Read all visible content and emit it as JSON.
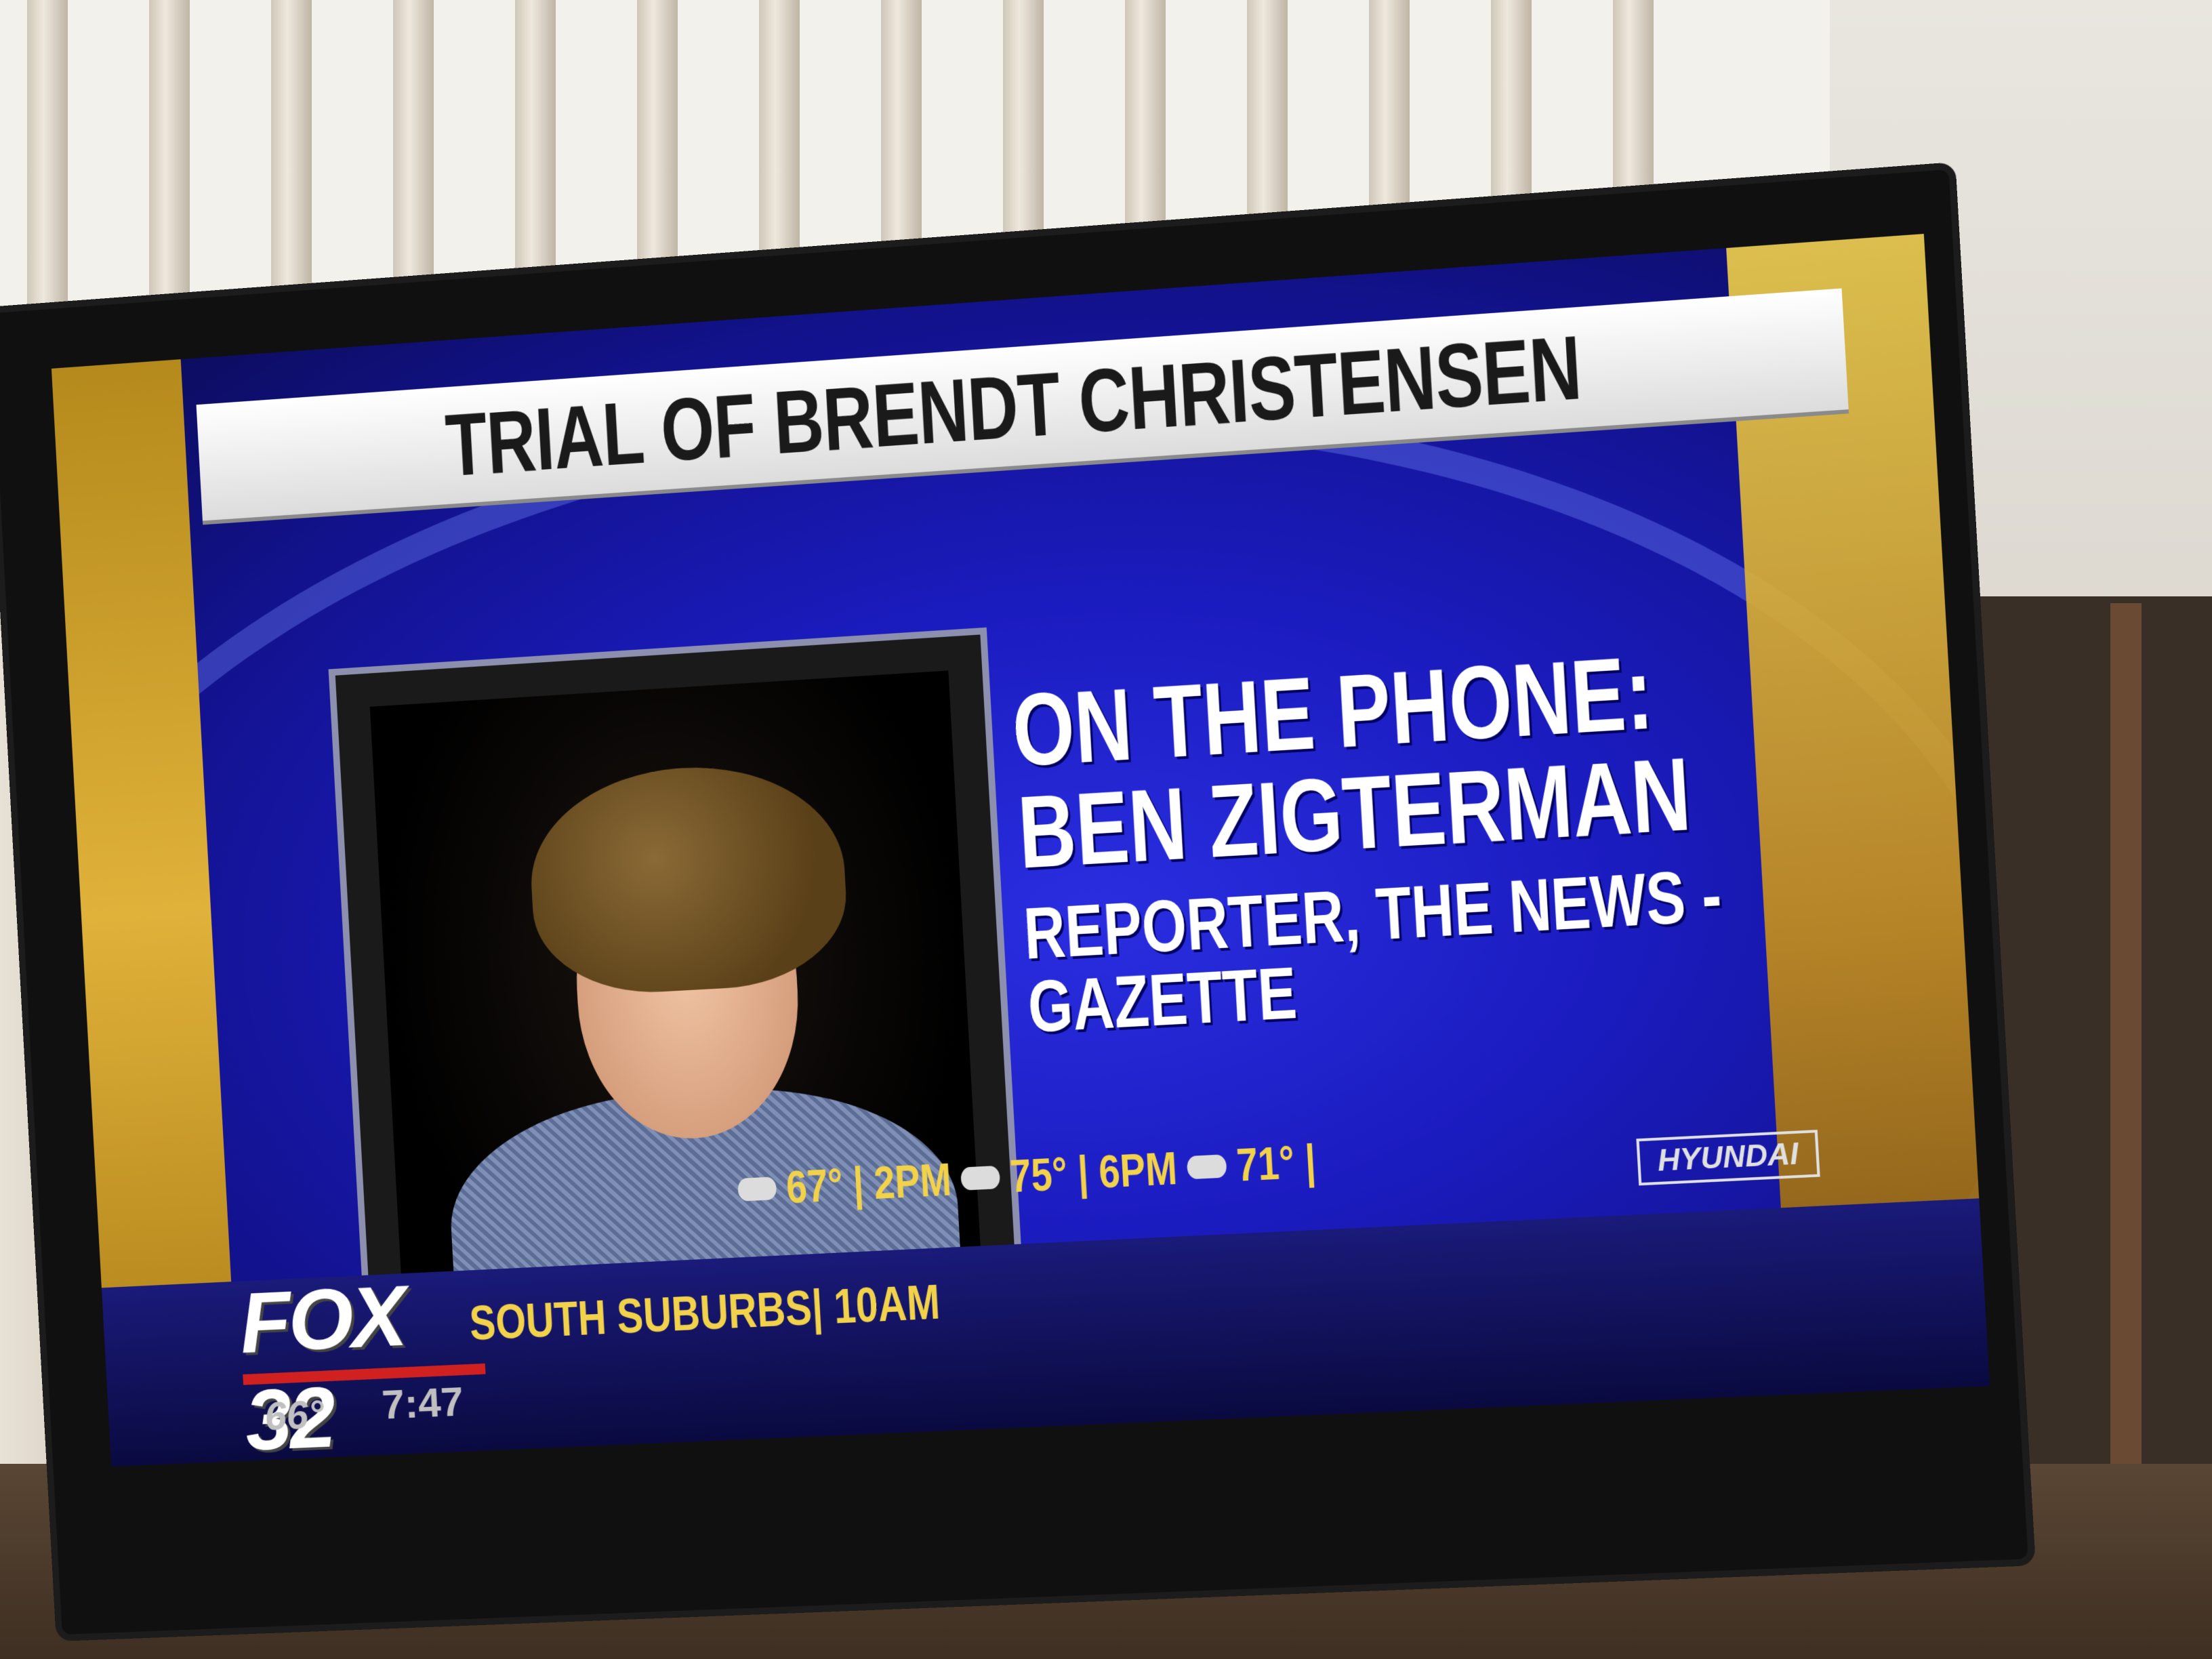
{
  "broadcast": {
    "headline": "TRIAL OF BRENDT CHRISTENSEN",
    "guest": {
      "label": "ON THE PHONE:",
      "name": "BEN ZIGTERMAN",
      "title_line1": "REPORTER, THE NEWS -",
      "title_line2": "GAZETTE"
    },
    "station_logo": "FOX 32",
    "current_temp": "66°",
    "current_time": "7:47",
    "forecast": {
      "region": "SOUTH SUBURBS",
      "items": [
        {
          "time": "10AM",
          "temp": "67°",
          "icon": "cloud-icon"
        },
        {
          "time": "2PM",
          "temp": "75°",
          "icon": "cloud-icon"
        },
        {
          "time": "6PM",
          "temp": "71°",
          "icon": "cloud-icon"
        }
      ]
    },
    "sponsor": "HYUNDAI"
  },
  "colors": {
    "background_blue": "#1b1cc0",
    "accent_gold": "#f2d24a",
    "logo_red": "#d02020",
    "banner_white": "#ffffff"
  }
}
